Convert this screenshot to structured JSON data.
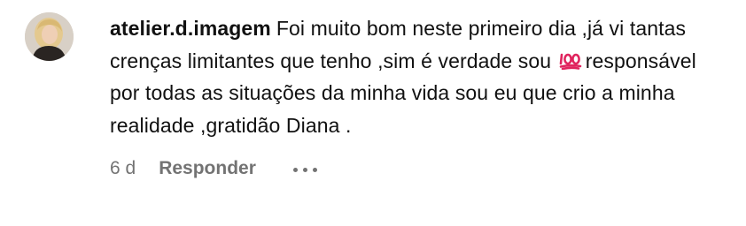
{
  "comment": {
    "username": "atelier.d.imagem",
    "text_part1": "Foi muito bom neste primeiro dia ,já vi tantas crenças limitantes que tenho ,sim é verdade sou",
    "emoji_icon": "hundred-points-icon",
    "text_part2": "responsável por todas as situações da minha vida sou eu que crio a minha realidade ,gratidão Diana .",
    "time": "6 d",
    "reply_label": "Responder",
    "more_icon": "more-options-icon"
  },
  "colors": {
    "text": "#111111",
    "meta": "#737373",
    "emoji": "#e0245e"
  }
}
